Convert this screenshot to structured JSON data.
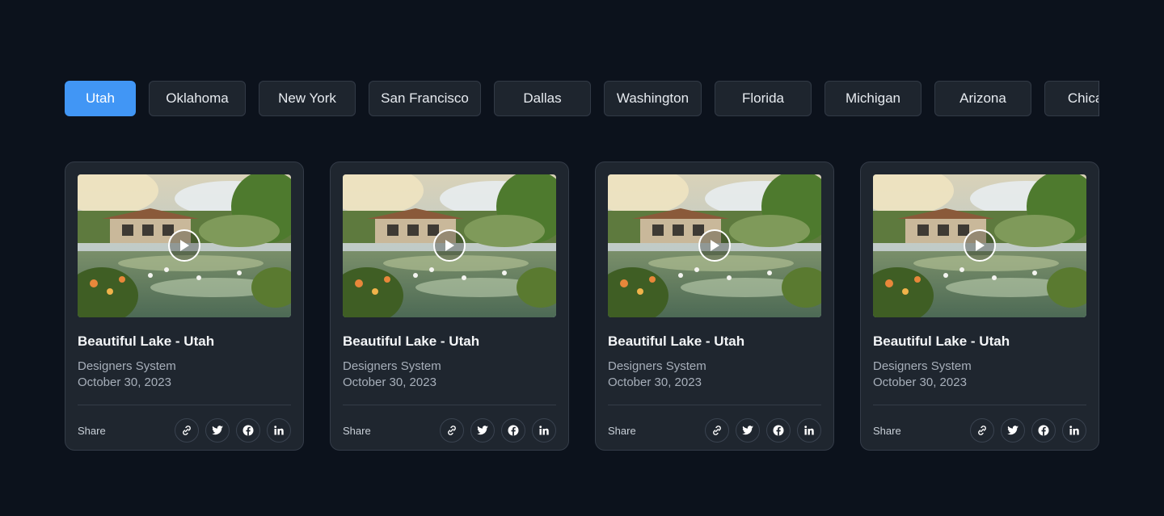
{
  "tabs": [
    {
      "label": "Utah",
      "active": true
    },
    {
      "label": "Oklahoma"
    },
    {
      "label": "New York"
    },
    {
      "label": "San Francisco"
    },
    {
      "label": "Dallas"
    },
    {
      "label": "Washington"
    },
    {
      "label": "Florida"
    },
    {
      "label": "Michigan"
    },
    {
      "label": "Arizona"
    },
    {
      "label": "Chicago"
    }
  ],
  "cards": [
    {
      "title": "Beautiful Lake - Utah",
      "author": "Designers System",
      "date": "October 30, 2023",
      "share_label": "Share"
    },
    {
      "title": "Beautiful Lake - Utah",
      "author": "Designers System",
      "date": "October 30, 2023",
      "share_label": "Share"
    },
    {
      "title": "Beautiful Lake - Utah",
      "author": "Designers System",
      "date": "October 30, 2023",
      "share_label": "Share"
    },
    {
      "title": "Beautiful Lake - Utah",
      "author": "Designers System",
      "date": "October 30, 2023",
      "share_label": "Share"
    }
  ],
  "share_icons": [
    "link-icon",
    "twitter-icon",
    "facebook-icon",
    "linkedin-icon"
  ],
  "colors": {
    "accent": "#4196f5",
    "background": "#0c121c",
    "card": "#1f262f"
  }
}
